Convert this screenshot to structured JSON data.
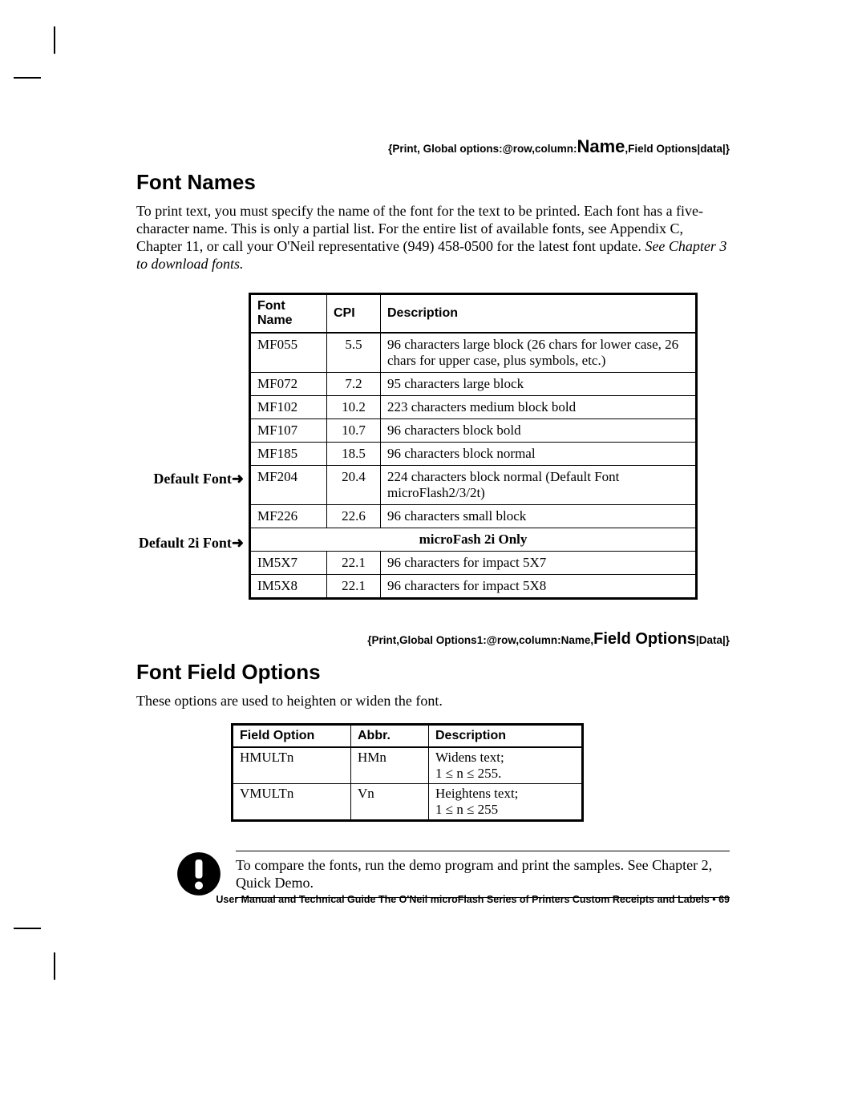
{
  "header_syntax": {
    "prefix": "{Print, Global options:@row,column:",
    "emph": "Name",
    "suffix": ",Field Options|data|}"
  },
  "section1": {
    "title": "Font Names",
    "para_plain": "To print text, you must specify the name of the font for the text to be printed. Each font has a five-character name.  This is only a partial list. For the entire list of available fonts, see Appendix C, Chapter 11, or call your O'Neil representative (949) 458-0500 for the latest font update. ",
    "para_italic": "See Chapter 3 to download fonts."
  },
  "font_table": {
    "headers": {
      "c1": "Font Name",
      "c2": "CPI",
      "c3": "Description"
    },
    "side_labels": {
      "default": "Default Font➜",
      "default2i": "Default 2i Font➜"
    },
    "rows": [
      {
        "name": "MF055",
        "cpi": "5.5",
        "desc": "96 characters large block (26 chars for lower case, 26 chars for upper case, plus symbols, etc.)"
      },
      {
        "name": "MF072",
        "cpi": "7.2",
        "desc": "95 characters large block"
      },
      {
        "name": "MF102",
        "cpi": "10.2",
        "desc": "223 characters medium block bold"
      },
      {
        "name": "MF107",
        "cpi": "10.7",
        "desc": "96 characters block bold"
      },
      {
        "name": "MF185",
        "cpi": "18.5",
        "desc": "96 characters block normal"
      },
      {
        "name": "MF204",
        "cpi": "20.4",
        "desc": "224 characters block normal (Default Font microFlash2/3/2t)"
      },
      {
        "name": "MF226",
        "cpi": "22.6",
        "desc": "96 characters small block"
      }
    ],
    "subheader": "microFash 2i Only",
    "rows2": [
      {
        "name": "IM5X7",
        "cpi": "22.1",
        "desc": "96 characters for impact 5X7"
      },
      {
        "name": "IM5X8",
        "cpi": "22.1",
        "desc": "96 characters for impact 5X8"
      }
    ]
  },
  "mid_syntax": {
    "prefix": "{Print,Global Options1:@row,column:Name,",
    "emph": "Field Options",
    "suffix": "|Data|}"
  },
  "section2": {
    "title": "Font Field Options",
    "para": "These options are used to heighten or widen the font."
  },
  "opt_table": {
    "headers": {
      "c1": "Field Option",
      "c2": "Abbr.",
      "c3": "Description"
    },
    "rows": [
      {
        "opt": "HMULTn",
        "abbr": "HMn",
        "desc": "Widens text;\n1 ≤ n ≤ 255."
      },
      {
        "opt": "VMULTn",
        "abbr": "Vn",
        "desc": "Heightens text;\n1 ≤ n ≤ 255"
      }
    ]
  },
  "note": "To compare the fonts, run the demo program and print the samples. See Chapter 2, Quick Demo.",
  "footer": "User Manual and Technical Guide The O'Neil microFlash Series of Printers  Custom Receipts and Labels • 69"
}
